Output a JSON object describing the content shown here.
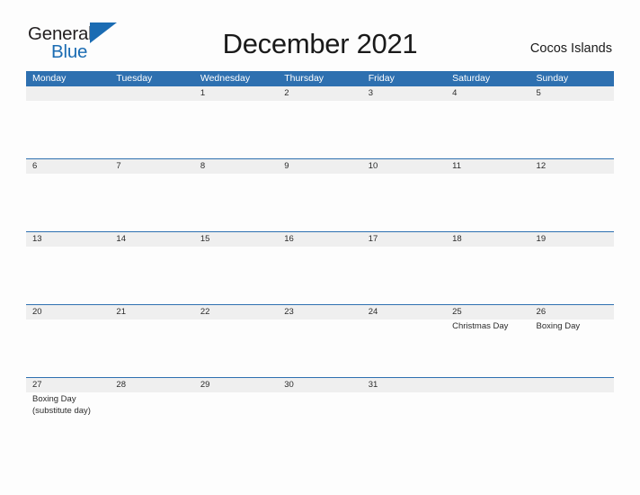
{
  "brand": {
    "name_line1": "General",
    "name_line2": "Blue",
    "flag_icon": "blue-triangle-flag",
    "accent_color": "#1b6cb3"
  },
  "header": {
    "title": "December 2021",
    "location": "Cocos Islands"
  },
  "theme": {
    "header_blue": "#2e70b0",
    "row_band_gray": "#efefef",
    "page_background": "#fdfdfd",
    "text_color": "#2b2b2b"
  },
  "weekdays": [
    "Monday",
    "Tuesday",
    "Wednesday",
    "Thursday",
    "Friday",
    "Saturday",
    "Sunday"
  ],
  "weeks": [
    {
      "days": [
        {
          "date": "",
          "events": []
        },
        {
          "date": "",
          "events": []
        },
        {
          "date": "1",
          "events": []
        },
        {
          "date": "2",
          "events": []
        },
        {
          "date": "3",
          "events": []
        },
        {
          "date": "4",
          "events": []
        },
        {
          "date": "5",
          "events": []
        }
      ]
    },
    {
      "days": [
        {
          "date": "6",
          "events": []
        },
        {
          "date": "7",
          "events": []
        },
        {
          "date": "8",
          "events": []
        },
        {
          "date": "9",
          "events": []
        },
        {
          "date": "10",
          "events": []
        },
        {
          "date": "11",
          "events": []
        },
        {
          "date": "12",
          "events": []
        }
      ]
    },
    {
      "days": [
        {
          "date": "13",
          "events": []
        },
        {
          "date": "14",
          "events": []
        },
        {
          "date": "15",
          "events": []
        },
        {
          "date": "16",
          "events": []
        },
        {
          "date": "17",
          "events": []
        },
        {
          "date": "18",
          "events": []
        },
        {
          "date": "19",
          "events": []
        }
      ]
    },
    {
      "days": [
        {
          "date": "20",
          "events": []
        },
        {
          "date": "21",
          "events": []
        },
        {
          "date": "22",
          "events": []
        },
        {
          "date": "23",
          "events": []
        },
        {
          "date": "24",
          "events": []
        },
        {
          "date": "25",
          "events": [
            "Christmas Day"
          ]
        },
        {
          "date": "26",
          "events": [
            "Boxing Day"
          ]
        }
      ]
    },
    {
      "days": [
        {
          "date": "27",
          "events": [
            "Boxing Day",
            "(substitute day)"
          ]
        },
        {
          "date": "28",
          "events": []
        },
        {
          "date": "29",
          "events": []
        },
        {
          "date": "30",
          "events": []
        },
        {
          "date": "31",
          "events": []
        },
        {
          "date": "",
          "events": []
        },
        {
          "date": "",
          "events": []
        }
      ]
    }
  ]
}
